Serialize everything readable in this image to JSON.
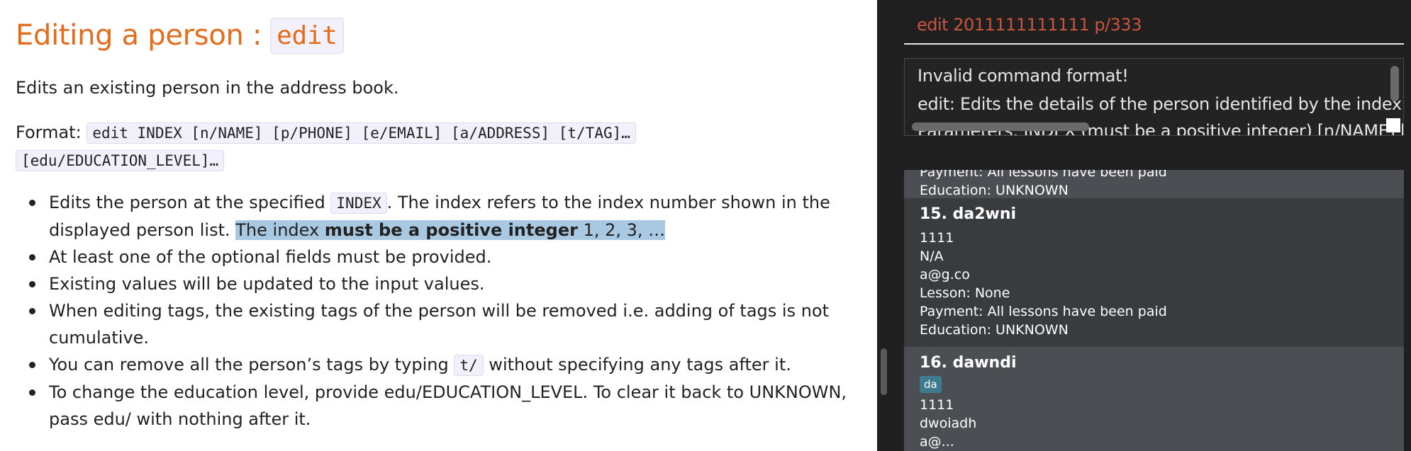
{
  "doc": {
    "heading": "Editing a person :",
    "heading_command": "edit",
    "intro": "Edits an existing person in the address book.",
    "format_label": "Format:",
    "format_code_1": "edit INDEX [n/NAME] [p/PHONE] [e/EMAIL] [a/ADDRESS] [t/TAG]…",
    "format_code_2": "[edu/EDUCATION_LEVEL]…",
    "bullets": {
      "b1_pre": "Edits the person at the specified",
      "b1_code": "INDEX",
      "b1_mid": ". The index refers to the index number shown in the",
      "b1_line2": "displayed person list.",
      "b1_hl_pre": "The index",
      "b1_hl_bold": "must be a positive integer",
      "b1_hl_post": "1, 2, 3, …",
      "b2": "At least one of the optional fields must be provided.",
      "b3": "Existing values will be updated to the input values.",
      "b4": "When editing tags, the existing tags of the person will be removed i.e. adding of tags is not cumulative.",
      "b5_pre": "You can remove all the person’s tags by typing",
      "b5_code": "t/",
      "b5_post": "without specifying any tags after it.",
      "b6": "To change the education level, provide edu/EDUCATION_LEVEL. To clear it back to UNKNOWN, pass edu/ with nothing after it."
    }
  },
  "app": {
    "command_input": "edit 2011111111111 p/333",
    "result_lines": [
      "Invalid command format!",
      "edit: Edits the details of the person identified by the index nu",
      "Parameters: INDEX (must be a positive integer) [n/NAME] [p"
    ],
    "partial_card": {
      "payment": "Payment: All lessons have been paid",
      "education": "Education: UNKNOWN"
    },
    "card15": {
      "title": "15. da2wni",
      "phone": "1111",
      "address": "N/A",
      "email": "a@g.co",
      "lesson": "Lesson: None",
      "payment": "Payment: All lessons have been paid",
      "education": "Education: UNKNOWN"
    },
    "card16": {
      "title": "16. dawndi",
      "tag": "da",
      "phone": "1111",
      "address": "dwoiadh",
      "email": "a@..."
    }
  },
  "colors": {
    "heading": "#e46c1c",
    "command_text_error": "#c8553d",
    "highlight": "#a9c9e3",
    "tag": "#3e7b91"
  }
}
